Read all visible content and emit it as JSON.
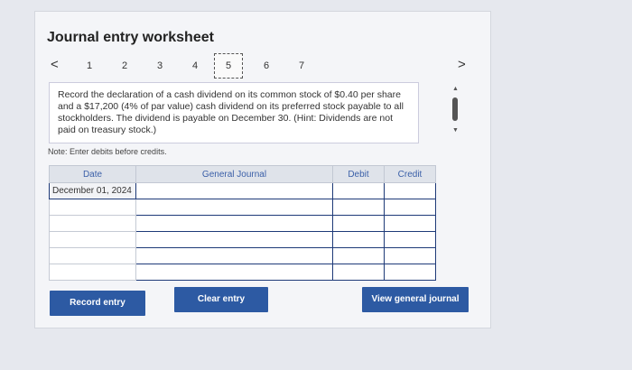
{
  "title": "Journal entry worksheet",
  "pager": {
    "prev": "<",
    "next": ">",
    "pages": [
      "1",
      "2",
      "3",
      "4",
      "5",
      "6",
      "7"
    ],
    "current": "5"
  },
  "prompt": "Record the declaration of a cash dividend on its common stock of $0.40 per share and a $17,200 (4% of par value) cash dividend on its preferred stock payable to all stockholders. The dividend is payable on December 30. (Hint: Dividends are not paid on treasury stock.)",
  "note": "Note: Enter debits before credits.",
  "table": {
    "headers": [
      "Date",
      "General Journal",
      "Debit",
      "Credit"
    ],
    "rows": [
      [
        "December 01, 2024",
        "",
        "",
        ""
      ],
      [
        "",
        "",
        "",
        ""
      ],
      [
        "",
        "",
        "",
        ""
      ],
      [
        "",
        "",
        "",
        ""
      ],
      [
        "",
        "",
        "",
        ""
      ],
      [
        "",
        "",
        "",
        ""
      ]
    ]
  },
  "buttons": {
    "record": "Record entry",
    "clear": "Clear entry",
    "view": "View general journal"
  }
}
